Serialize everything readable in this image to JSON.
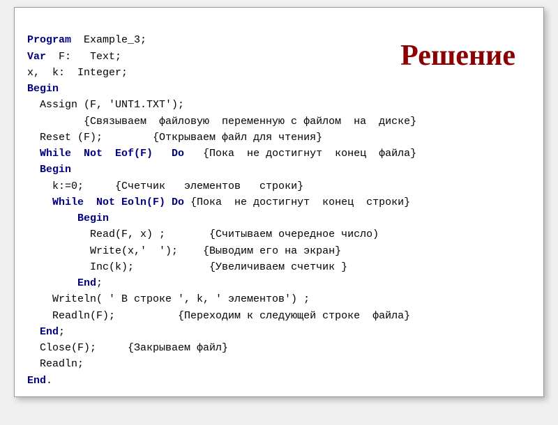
{
  "title": "Решение",
  "code": {
    "l1_program": "Program",
    "l1_name": "  Example_3;",
    "l2_var": "Var",
    "l2_decl": "  F:   Text;",
    "l3": "x,  k:  Integer;",
    "l4_begin": "Begin",
    "l5a": "  Assign (F, 'UNT1.TXT');",
    "l6_cmt": "         {Связываем  файловую  переменную с файлом  на  диске}",
    "l7a": "  Reset (F);",
    "l7b": "        {Открываем файл для чтения}",
    "l8a": "  While  Not  Eof(F)   Do",
    "l8b": "   {Пока  не достигнут  конец  файла}",
    "l9_begin": "  Begin",
    "l10a": "    k:=0;",
    "l10b": "     {Счетчик   элементов   строки}",
    "l11a": "    While  Not Eoln(F) Do",
    "l11b": " {Пока  не достигнут  конец  строки}",
    "l12_begin": "        Begin",
    "l13a": "          Read(F, x) ;",
    "l13b": "       {Считываем очередное число)",
    "l14a": "          Write(x,'  ');",
    "l14b": "    {Выводим его на экран}",
    "l15a": "          Inc(k);",
    "l15b": "            {Увеличиваем счетчик }",
    "l16_end": "        End",
    "l16_semi": ";",
    "l17": "    Writeln( ' В строке ', k, ' элементов') ;",
    "l18a": "    Readln(F);",
    "l18b": "          {Переходим к следующей строке  файла}",
    "l19_end": "  End",
    "l19_semi": ";",
    "l20a": "  Close(F);",
    "l20b": "     {Закрываем файл}",
    "l21": "  Readln;",
    "l22_end": "End",
    "l22_dot": "."
  }
}
